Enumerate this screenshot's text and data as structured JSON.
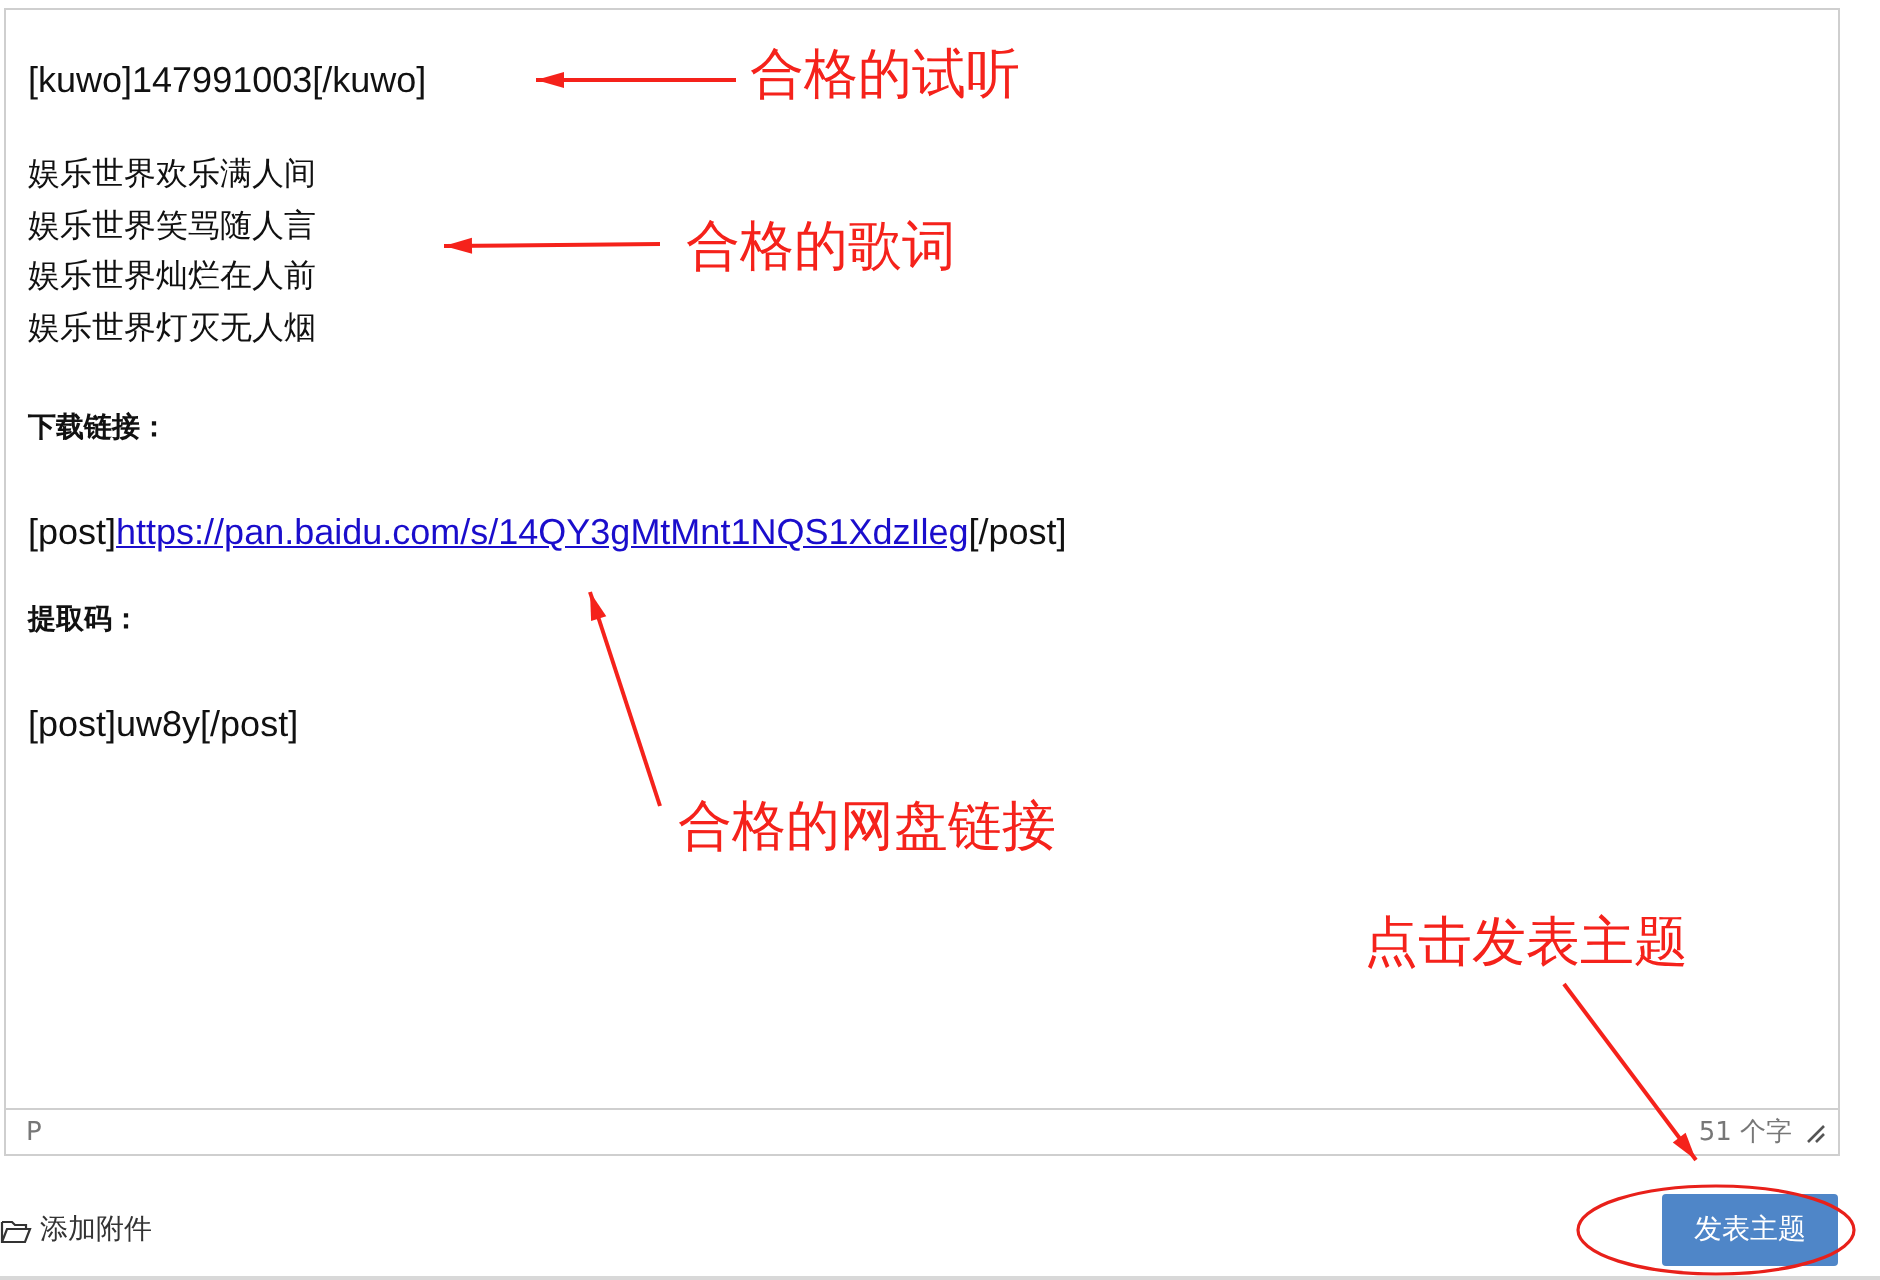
{
  "editor": {
    "blocks": [
      {
        "kind": "line",
        "text": "[kuwo]147991003[/kuwo]"
      },
      {
        "kind": "lyrics",
        "lines": [
          "娱乐世界欢乐满人间",
          "娱乐世界笑骂随人言",
          "娱乐世界灿烂在人前",
          "娱乐世界灯灭无人烟"
        ]
      },
      {
        "kind": "label",
        "text": "下载链接："
      },
      {
        "kind": "link-line",
        "before": "[post]",
        "link": "https://pan.baidu.com/s/14QY3gMtMnt1NQS1XdzIleg",
        "after": "[/post]"
      },
      {
        "kind": "label",
        "text": "提取码："
      },
      {
        "kind": "line",
        "text": "[post]uw8y[/post]"
      }
    ]
  },
  "status_bar": {
    "path": "P",
    "count": "51 个字"
  },
  "footer": {
    "attach": "添加附件",
    "submit": "发表主题"
  },
  "annotations": [
    {
      "kind": "arrow-label",
      "text": "合格的试听"
    },
    {
      "kind": "arrow-label",
      "text": "合格的歌词"
    },
    {
      "kind": "arrow-label",
      "text": "合格的网盘链接"
    },
    {
      "kind": "arrow-label",
      "text": "点击发表主题"
    },
    {
      "kind": "ellipse"
    }
  ]
}
